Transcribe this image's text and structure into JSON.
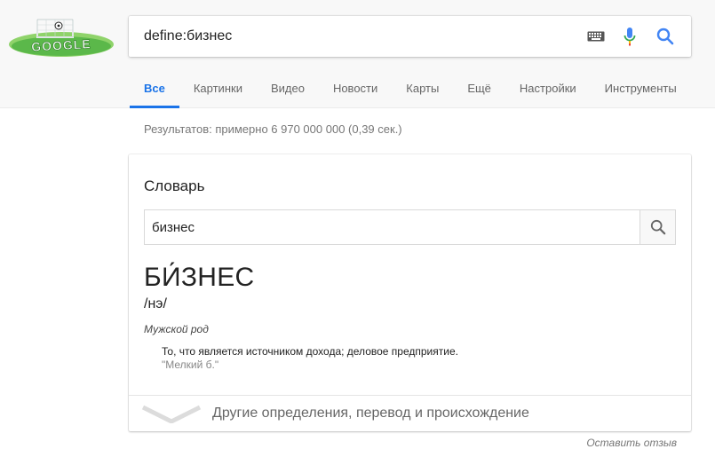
{
  "logo": {
    "text": "GOOGLE"
  },
  "search": {
    "query": "define:бизнес"
  },
  "tabs": [
    {
      "label": "Все",
      "active": true
    },
    {
      "label": "Картинки"
    },
    {
      "label": "Видео"
    },
    {
      "label": "Новости"
    },
    {
      "label": "Карты"
    },
    {
      "label": "Ещё"
    },
    {
      "label": "Настройки"
    },
    {
      "label": "Инструменты"
    }
  ],
  "stats": "Результатов: примерно 6 970 000 000 (0,39 сек.)",
  "dictionary": {
    "title": "Словарь",
    "input_value": "бизнес",
    "word": "БИ́ЗНЕС",
    "phonetic": "/нэ/",
    "part_of_speech": "Мужской род",
    "definition": "То, что является источником дохода; деловое предприятие.",
    "example": "\"Мелкий б.\"",
    "more_label": "Другие определения, перевод и происхождение"
  },
  "feedback": "Оставить отзыв",
  "colors": {
    "accent": "#1a73e8",
    "mic_blue": "#4285f4",
    "mic_red": "#ea4335",
    "logo_green": "#5bb84a"
  }
}
